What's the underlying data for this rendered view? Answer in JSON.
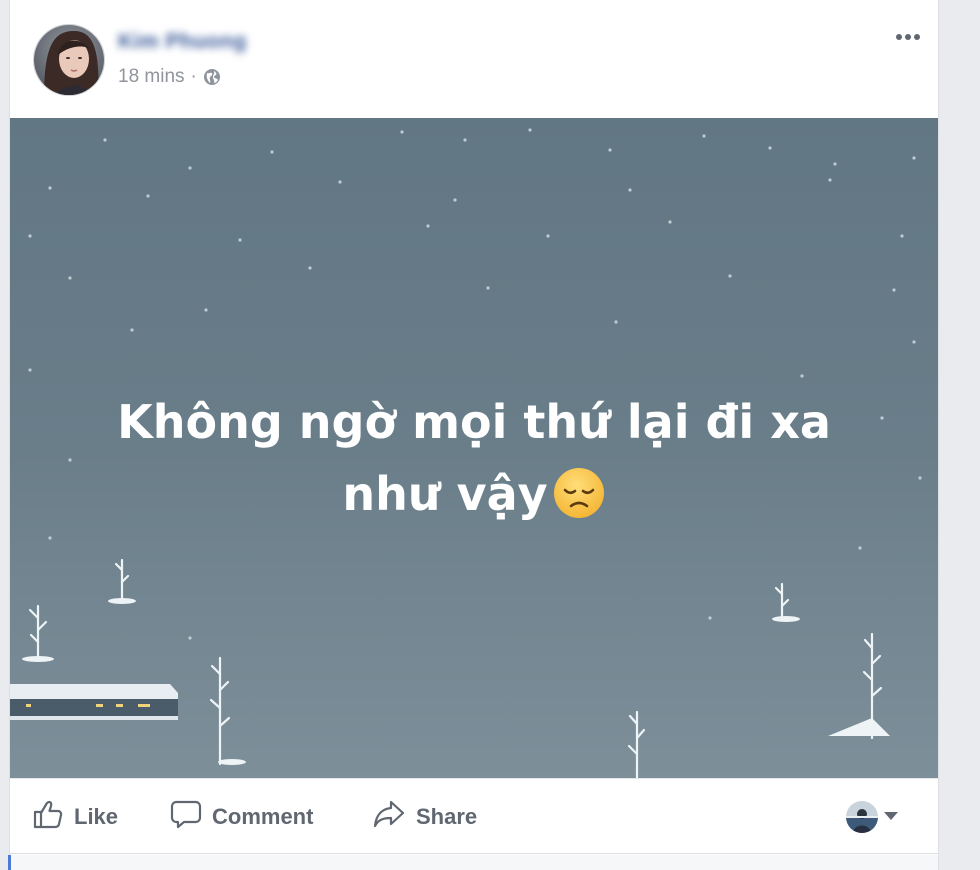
{
  "post": {
    "author_name": "Kim Phuong",
    "timestamp": "18 mins",
    "separator": "·",
    "privacy_icon": "globe-icon",
    "more_icon": "more-options-icon",
    "text_line1": "Không ngờ mọi thứ lại đi xa",
    "text_line2": "như vậy",
    "emoji": "sad-face-emoji",
    "background_color": "#6b808d"
  },
  "actions": {
    "like_label": "Like",
    "comment_label": "Comment",
    "share_label": "Share",
    "audience_icon": "profile-avatar",
    "caret_icon": "caret-down-icon"
  }
}
